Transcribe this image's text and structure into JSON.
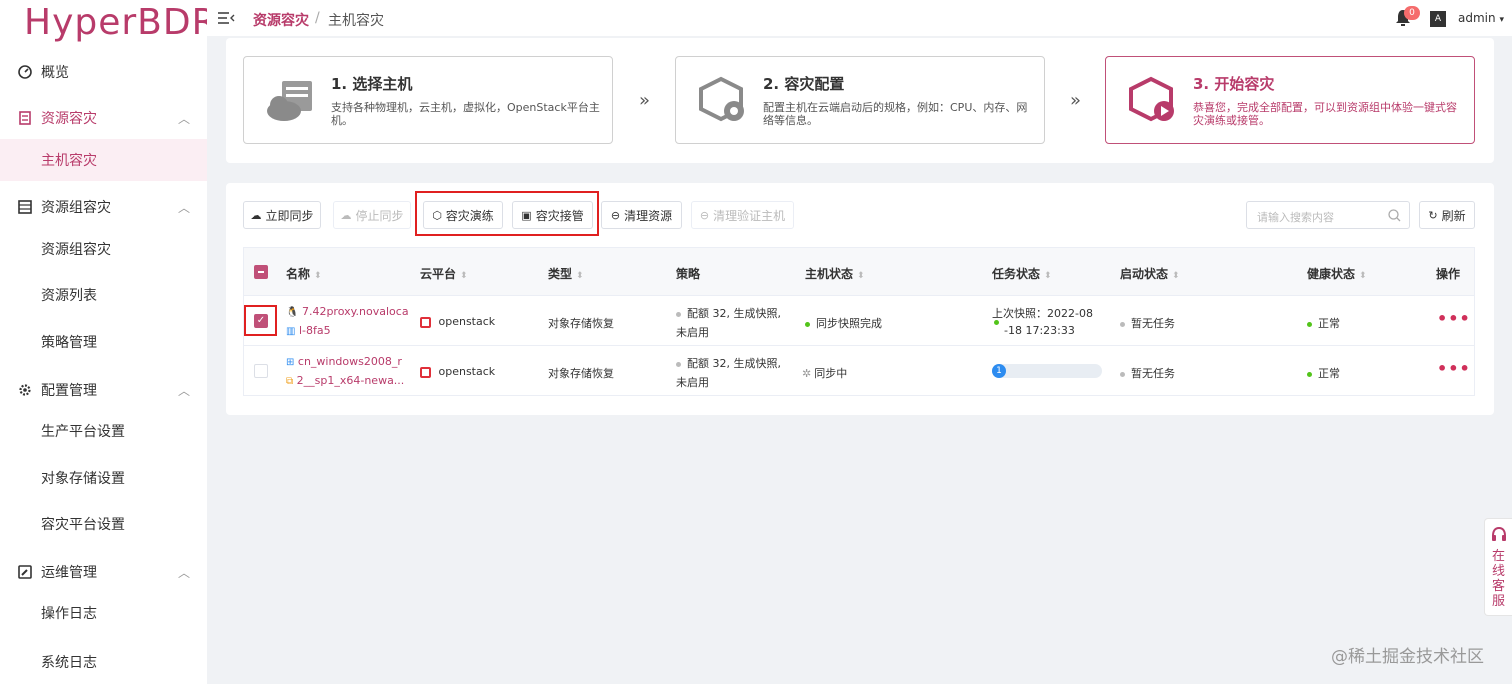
{
  "app": {
    "logo": "HyperBDR"
  },
  "sidebar": {
    "items": [
      {
        "label": "概览"
      },
      {
        "label": "资源容灾"
      },
      {
        "label": "主机容灾"
      },
      {
        "label": "资源组容灾"
      },
      {
        "label": "资源组容灾"
      },
      {
        "label": "资源列表"
      },
      {
        "label": "策略管理"
      },
      {
        "label": "配置管理"
      },
      {
        "label": "生产平台设置"
      },
      {
        "label": "对象存储设置"
      },
      {
        "label": "容灾平台设置"
      },
      {
        "label": "运维管理"
      },
      {
        "label": "操作日志"
      },
      {
        "label": "系统日志"
      }
    ]
  },
  "header": {
    "breadcrumb": [
      "资源容灾",
      "主机容灾"
    ],
    "separator": "/",
    "notification_count": "0",
    "lang_icon": "A",
    "user": "admin"
  },
  "steps": [
    {
      "title": "1. 选择主机",
      "desc": "支持各种物理机，云主机，虚拟化，OpenStack平台主机。"
    },
    {
      "title": "2. 容灾配置",
      "desc": "配置主机在云端启动后的规格，例如：CPU、内存、网络等信息。"
    },
    {
      "title": "3. 开始容灾",
      "desc": "恭喜您，完成全部配置，可以到资源组中体验一键式容灾演练或接管。"
    }
  ],
  "toolbar": {
    "sync_now": "立即同步",
    "stop_sync": "停止同步",
    "dr_drill": "容灾演练",
    "dr_takeover": "容灾接管",
    "clean_resources": "清理资源",
    "clean_verify_host": "清理验证主机",
    "search_placeholder": "请输入搜索内容",
    "refresh": "刷新"
  },
  "table": {
    "columns": [
      "名称",
      "云平台",
      "类型",
      "策略",
      "主机状态",
      "任务状态",
      "启动状态",
      "健康状态",
      "操作"
    ],
    "rows": [
      {
        "checked": true,
        "name_line1": "7.42proxy.novaloca",
        "name_line2": "l-8fa5",
        "platform": "openstack",
        "type": "对象存储恢复",
        "policy_line1": "配额 32, 生成快照,",
        "policy_line2": "未启用",
        "host_status": "同步快照完成",
        "task_line1": "上次快照：2022-08",
        "task_line2": "-18 17:23:33",
        "boot_status": "暂无任务",
        "health": "正常",
        "more": "•••"
      },
      {
        "checked": false,
        "name_line1": "cn_windows2008_r",
        "name_line2": "2__sp1_x64-newa...",
        "platform": "openstack",
        "type": "对象存储恢复",
        "policy_line1": "配额 32, 生成快照,",
        "policy_line2": "未启用",
        "host_status": "同步中",
        "task_progress_label": "1",
        "task_progress": 0.02,
        "boot_status": "暂无任务",
        "health": "正常",
        "more": "•••"
      }
    ]
  },
  "service": {
    "label": "在线客服"
  },
  "watermark": "@稀土掘金技术社区",
  "colors": {
    "brand": "#b83b6a",
    "success": "#52c41a",
    "progress": "#2d8cf0",
    "highlight_box": "#e02020"
  }
}
